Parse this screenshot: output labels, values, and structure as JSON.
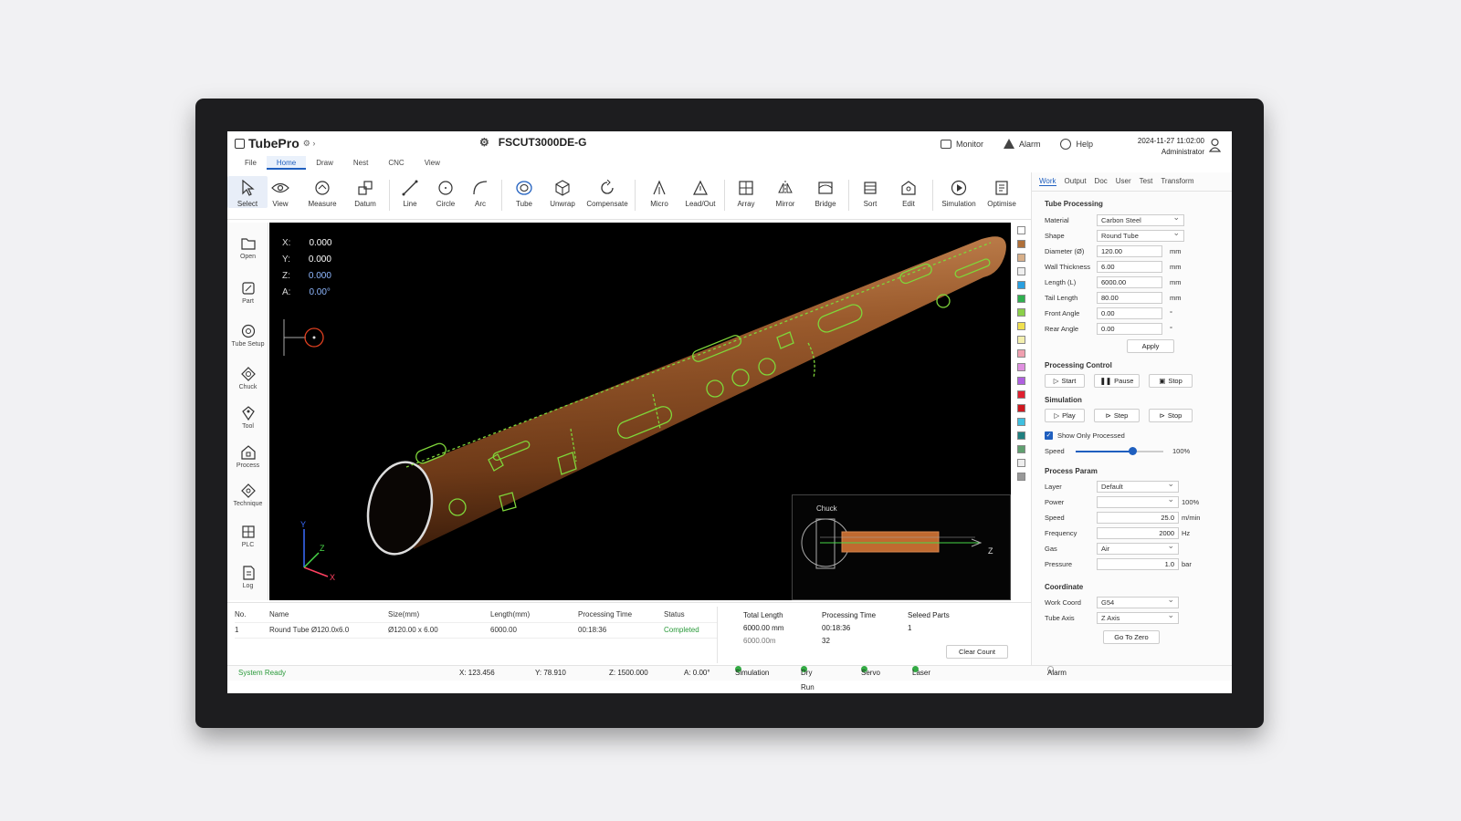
{
  "app": {
    "name": "TubePro",
    "machine": "FSCUT3000DE-G",
    "datetime": "2024-11-27 11:02:00",
    "user": "Administrator",
    "nav": {
      "monitor": "Monitor",
      "alarm": "Alarm",
      "help": "Help"
    }
  },
  "menu": [
    "File",
    "Home",
    "Draw",
    "Nest",
    "CNC",
    "View"
  ],
  "ribbon": {
    "select": "Select",
    "view": "View",
    "measure": "Measure",
    "datum": "Datum",
    "line": "Line",
    "circle": "Circle",
    "arc": "Arc",
    "tube": "Tube",
    "unwrap": "Unwrap",
    "compensate": "Compensate",
    "micro": "Micro",
    "leadout": "Lead/Out",
    "array": "Array",
    "mirror": "Mirror",
    "bridge": "Bridge",
    "sort": "Sort",
    "edit": "Edit",
    "simulation": "Simulation",
    "optimise": "Optimise"
  },
  "left_tools": [
    "Open",
    "Part",
    "Tube Setup",
    "Chuck",
    "Tool",
    "Process",
    "Technique",
    "PLC",
    "Log"
  ],
  "viewport": {
    "coords": [
      {
        "label": "X:",
        "value": "0.000"
      },
      {
        "label": "Y:",
        "value": "0.000"
      },
      {
        "label": "Z:",
        "value": "0.000"
      },
      {
        "label": "A:",
        "value": "0.00°"
      }
    ],
    "minimap_label": "Chuck",
    "minimap_axis": "Z",
    "axis_labels": {
      "x": "X",
      "y": "Y",
      "z": "Z"
    },
    "colors": {
      "tube": "#8a4b1f",
      "cut_path": "#7fd63a",
      "background": "#000000"
    }
  },
  "palette": [
    "#ffffff",
    "#b0703a",
    "#d8b08a",
    "#f0f0f0",
    "#2aa0e0",
    "#30b050",
    "#8bd04a",
    "#f0e050",
    "#f4f0b0",
    "#f0a0b0",
    "#e090e0",
    "#b060e0",
    "#e02030",
    "#d01820",
    "#40c0e0",
    "#208080",
    "#60a070",
    "#eeeeee",
    "#999999"
  ],
  "right_panel": {
    "tabs": [
      "Work",
      "Output",
      "Doc",
      "User",
      "Test",
      "Transform"
    ],
    "tube_processing": {
      "title": "Tube Processing",
      "material_label": "Material",
      "material": "Carbon Steel",
      "shape_label": "Shape",
      "shape": "Round Tube",
      "fields": [
        {
          "label": "Diameter (Ø)",
          "value": "120.00",
          "unit": "mm"
        },
        {
          "label": "Wall Thickness",
          "value": "6.00",
          "unit": "mm"
        },
        {
          "label": "Length (L)",
          "value": "6000.00",
          "unit": "mm"
        },
        {
          "label": "Tail Length",
          "value": "80.00",
          "unit": "mm"
        },
        {
          "label": "Front Angle",
          "value": "0.00",
          "unit": "°"
        },
        {
          "label": "Rear Angle",
          "value": "0.00",
          "unit": "°"
        }
      ],
      "apply": "Apply"
    },
    "processing_control": {
      "title": "Processing Control",
      "start": "Start",
      "pause": "Pause",
      "stop": "Stop"
    },
    "simulation": {
      "title": "Simulation",
      "play": "Play",
      "step": "Step",
      "stop": "Stop",
      "show_only_processed": "Show Only Processed",
      "speed_label": "Speed",
      "speed_value": "100%",
      "speed_fraction": 0.65
    },
    "process_param": {
      "title": "Process Param",
      "layer_label": "Layer",
      "layer": "Default",
      "power_label": "Power",
      "power_unit": "100%",
      "speed_label": "Speed",
      "speed": "25.0",
      "speed_unit": "m/min",
      "frequency_label": "Frequency",
      "frequency": "2000",
      "frequency_unit": "Hz",
      "gas_label": "Gas",
      "gas": "Air",
      "pressure_label": "Pressure",
      "pressure": "1.0",
      "pressure_unit": "bar"
    },
    "coordinate": {
      "title": "Coordinate",
      "work_label": "Work Coord",
      "work": "G54",
      "axis_label": "Tube Axis",
      "axis": "Z Axis",
      "go_zero": "Go To Zero"
    }
  },
  "parts_table": {
    "headers": [
      "No.",
      "Name",
      "Size(mm)",
      "Length(mm)",
      "Processing Time",
      "Status"
    ],
    "rows": [
      [
        "1",
        "Round Tube Ø120.0x6.0",
        "Ø120.00 x 6.00",
        "6000.00",
        "00:18:36",
        "Completed"
      ]
    ]
  },
  "summary": {
    "total_length_label": "Total Length",
    "total_length": "6000.00 mm",
    "total_length_sub": "6000.00m",
    "processing_time_label": "Processing Time",
    "processing_time": "00:18:36",
    "processing_count": "32",
    "selected_label": "Seleed Parts",
    "selected": "1",
    "clear_count": "Clear Count"
  },
  "status_bar": {
    "message": "System Ready",
    "x": "X:  123.456",
    "y": "Y:  78.910",
    "z": "Z:  1500.000",
    "a": "A:  0.00°",
    "indicators": [
      "Simulation",
      "Dry Run",
      "Servo",
      "Laser"
    ],
    "alarm": "Alarm"
  }
}
